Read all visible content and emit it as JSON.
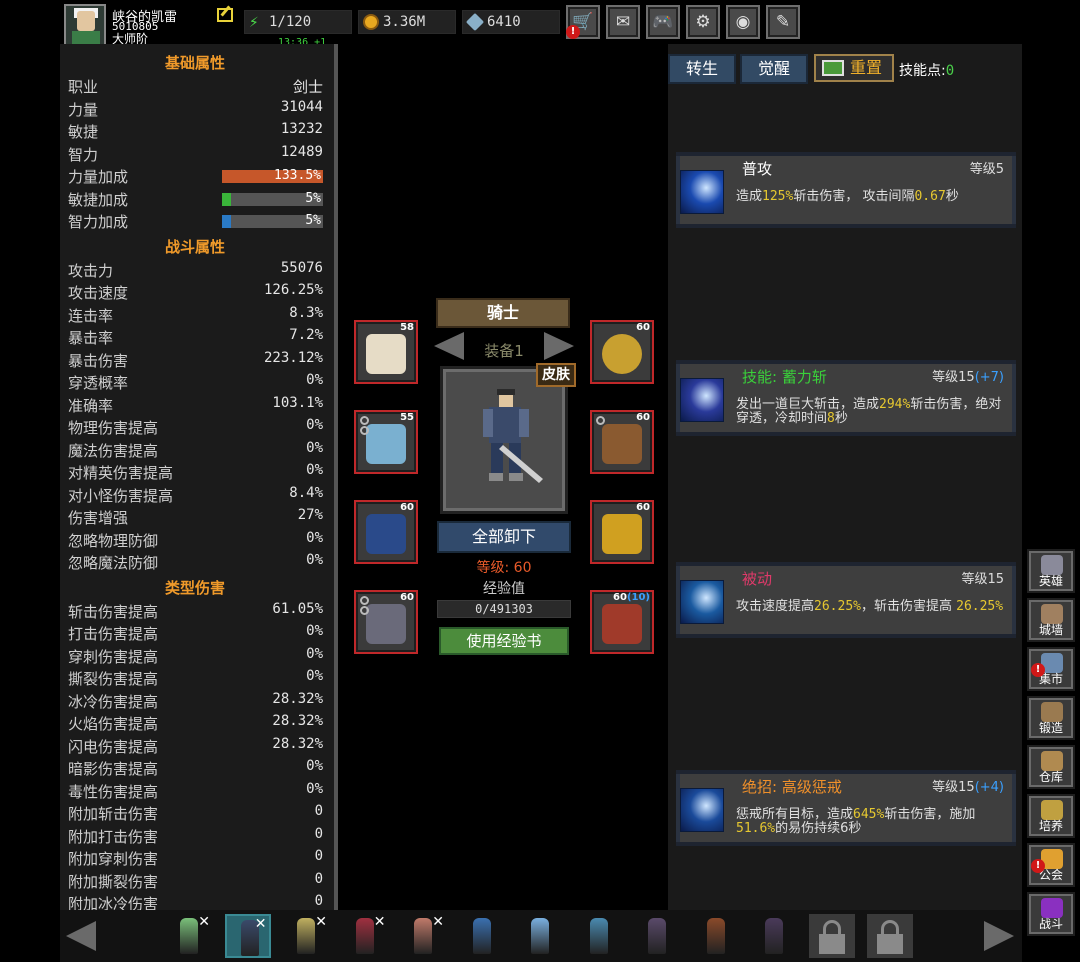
{
  "player": {
    "name": "峡谷的凯雷",
    "id": "5010805",
    "title": "大师阶"
  },
  "resources": {
    "energy": "1/120",
    "gold": "3.36M",
    "gems": "6410",
    "timer": "13:36 +1"
  },
  "top_buttons": [
    {
      "name": "shop-button",
      "icon": "cart-icon",
      "glyph": "🛒",
      "alert": true
    },
    {
      "name": "mail-button",
      "icon": "mail-icon",
      "glyph": "✉",
      "alert": false
    },
    {
      "name": "gamepad-button",
      "icon": "gamepad-icon",
      "glyph": "🎮",
      "alert": false
    },
    {
      "name": "settings-button",
      "icon": "gear-icon",
      "glyph": "⚙",
      "alert": false
    },
    {
      "name": "wheel-button",
      "icon": "color-wheel-icon",
      "glyph": "◉",
      "alert": false
    },
    {
      "name": "feather-button",
      "icon": "feather-icon",
      "glyph": "✎",
      "alert": false
    }
  ],
  "alert_mark": "!",
  "stats": {
    "basic_header": "基础属性",
    "basic": [
      {
        "label": "职业",
        "value": "剑士"
      },
      {
        "label": "力量",
        "value": "31044"
      },
      {
        "label": "敏捷",
        "value": "13232"
      },
      {
        "label": "智力",
        "value": "12489"
      }
    ],
    "bonus": [
      {
        "label": "力量加成",
        "value": "133.5%",
        "fill": 1.0,
        "color": "#c6572a"
      },
      {
        "label": "敏捷加成",
        "value": "5%",
        "fill": 0.09,
        "color": "#3ab53a"
      },
      {
        "label": "智力加成",
        "value": "5%",
        "fill": 0.09,
        "color": "#2a7ac6"
      }
    ],
    "combat_header": "战斗属性",
    "combat": [
      {
        "label": "攻击力",
        "value": "55076"
      },
      {
        "label": "攻击速度",
        "value": "126.25%"
      },
      {
        "label": "连击率",
        "value": "8.3%"
      },
      {
        "label": "暴击率",
        "value": "7.2%"
      },
      {
        "label": "暴击伤害",
        "value": "223.12%"
      },
      {
        "label": "穿透概率",
        "value": "0%"
      },
      {
        "label": "准确率",
        "value": "103.1%"
      },
      {
        "label": "物理伤害提高",
        "value": "0%"
      },
      {
        "label": "魔法伤害提高",
        "value": "0%"
      },
      {
        "label": "对精英伤害提高",
        "value": "0%"
      },
      {
        "label": "对小怪伤害提高",
        "value": "8.4%"
      },
      {
        "label": "伤害增强",
        "value": "27%"
      },
      {
        "label": "忽略物理防御",
        "value": "0%"
      },
      {
        "label": "忽略魔法防御",
        "value": "0%"
      }
    ],
    "type_header": "类型伤害",
    "type": [
      {
        "label": "斩击伤害提高",
        "value": "61.05%"
      },
      {
        "label": "打击伤害提高",
        "value": "0%"
      },
      {
        "label": "穿刺伤害提高",
        "value": "0%"
      },
      {
        "label": "撕裂伤害提高",
        "value": "0%"
      },
      {
        "label": "冰冷伤害提高",
        "value": "28.32%"
      },
      {
        "label": "火焰伤害提高",
        "value": "28.32%"
      },
      {
        "label": "闪电伤害提高",
        "value": "28.32%"
      },
      {
        "label": "暗影伤害提高",
        "value": "0%"
      },
      {
        "label": "毒性伤害提高",
        "value": "0%"
      },
      {
        "label": "附加斩击伤害",
        "value": "0"
      },
      {
        "label": "附加打击伤害",
        "value": "0"
      },
      {
        "label": "附加穿刺伤害",
        "value": "0"
      },
      {
        "label": "附加撕裂伤害",
        "value": "0"
      },
      {
        "label": "附加冰冷伤害",
        "value": "0"
      }
    ]
  },
  "equipment": {
    "class_name": "骑士",
    "set_label": "装备1",
    "skin_label": "皮肤",
    "unequip_label": "全部卸下",
    "level_text": "等级: 60",
    "exp_label": "经验值",
    "exp_value": "0/491303",
    "exp_fill": 0,
    "exp_book_label": "使用经验书",
    "slots": [
      {
        "name": "helmet-slot",
        "level": "58",
        "plus": "",
        "icon": "helmet-icon",
        "color": "#e6dcc6"
      },
      {
        "name": "chest-slot",
        "level": "55",
        "plus": "",
        "icon": "armor-icon",
        "color": "#7ab0d0"
      },
      {
        "name": "legs-slot",
        "level": "60",
        "plus": "",
        "icon": "pants-icon",
        "color": "#2a4a8a"
      },
      {
        "name": "boots-slot",
        "level": "60",
        "plus": "",
        "icon": "boots-icon",
        "color": "#6a6a7a"
      },
      {
        "name": "necklace-slot",
        "level": "60",
        "plus": "",
        "icon": "necklace-icon",
        "color": "#c8a030"
      },
      {
        "name": "gloves-slot",
        "level": "60",
        "plus": "",
        "icon": "gauntlet-icon",
        "color": "#8a5a30"
      },
      {
        "name": "ring-slot",
        "level": "60",
        "plus": "",
        "icon": "bracer-icon",
        "color": "#d0a020"
      },
      {
        "name": "weapon-slot",
        "level": "60",
        "plus": "(10)",
        "icon": "sword-icon",
        "color": "#a03a2a"
      }
    ]
  },
  "skills_panel": {
    "tabs": [
      "转生",
      "觉醒"
    ],
    "reset_label": "重置",
    "skill_points_label": "技能点:",
    "skill_points": "0",
    "cards": [
      {
        "name": "普攻",
        "name_color": "#ffffff",
        "level": "等级5",
        "plus": "",
        "desc": [
          "造成",
          "125%",
          "斩击伤害， 攻击间隔",
          "0.67",
          "秒"
        ]
      },
      {
        "name": "技能: 蓄力斩",
        "name_color": "#3ad03a",
        "level": "等级15",
        "plus": "(+7)",
        "desc": [
          "发出一道巨大斩击，造成",
          "294%",
          "斩击伤害，绝对穿透，冷却时间",
          "8",
          "秒"
        ]
      },
      {
        "name": "被动",
        "name_color": "#e03a6a",
        "level": "等级15",
        "plus": "",
        "desc": [
          "攻击速度提高",
          "26.25%",
          "，斩击伤害提高 ",
          "26.25%",
          ""
        ]
      },
      {
        "name": "绝招: 高级惩戒",
        "name_color": "#f0902a",
        "level": "等级15",
        "plus": "(+4)",
        "desc": [
          "惩戒所有目标，造成",
          "645%",
          "斩击伤害，施加 ",
          "51.6%",
          "的易伤持续6秒"
        ]
      }
    ]
  },
  "side_nav": [
    {
      "label": "英雄",
      "icon": "helmet-icon",
      "color": "#8a8a9a",
      "alert": false
    },
    {
      "label": "城墙",
      "icon": "wall-icon",
      "color": "#a08060",
      "alert": false
    },
    {
      "label": "集市",
      "icon": "market-icon",
      "color": "#6a8ab0",
      "alert": true
    },
    {
      "label": "锻造",
      "icon": "anvil-icon",
      "color": "#9a7a50",
      "alert": false
    },
    {
      "label": "仓库",
      "icon": "storage-icon",
      "color": "#b08a50",
      "alert": false
    },
    {
      "label": "培养",
      "icon": "chalice-icon",
      "color": "#c0a040",
      "alert": false
    },
    {
      "label": "公会",
      "icon": "guild-icon",
      "color": "#e0a030",
      "alert": true
    },
    {
      "label": "战斗",
      "icon": "portal-icon",
      "color": "#8a30c0",
      "alert": false
    }
  ],
  "heroes": [
    {
      "name": "hero-1",
      "color": "#7ac07a",
      "removable": true,
      "selected": false
    },
    {
      "name": "hero-2",
      "color": "#3a4a6a",
      "removable": true,
      "selected": true
    },
    {
      "name": "hero-3",
      "color": "#c0b060",
      "removable": true,
      "selected": false
    },
    {
      "name": "hero-4",
      "color": "#a03040",
      "removable": true,
      "selected": false
    },
    {
      "name": "hero-5",
      "color": "#c07a6a",
      "removable": true,
      "selected": false
    },
    {
      "name": "hero-6",
      "color": "#3a70b0",
      "removable": false,
      "selected": false
    },
    {
      "name": "hero-7",
      "color": "#7ab0e0",
      "removable": false,
      "selected": false
    },
    {
      "name": "hero-8",
      "color": "#4a8ab0",
      "removable": false,
      "selected": false
    },
    {
      "name": "hero-9",
      "color": "#5a4a6a",
      "removable": false,
      "selected": false
    },
    {
      "name": "hero-10",
      "color": "#8a4a2a",
      "removable": false,
      "selected": false
    },
    {
      "name": "hero-11",
      "color": "#4a3a5a",
      "removable": false,
      "selected": false
    }
  ],
  "hero_remove_mark": "✕",
  "locked_slots": 2
}
